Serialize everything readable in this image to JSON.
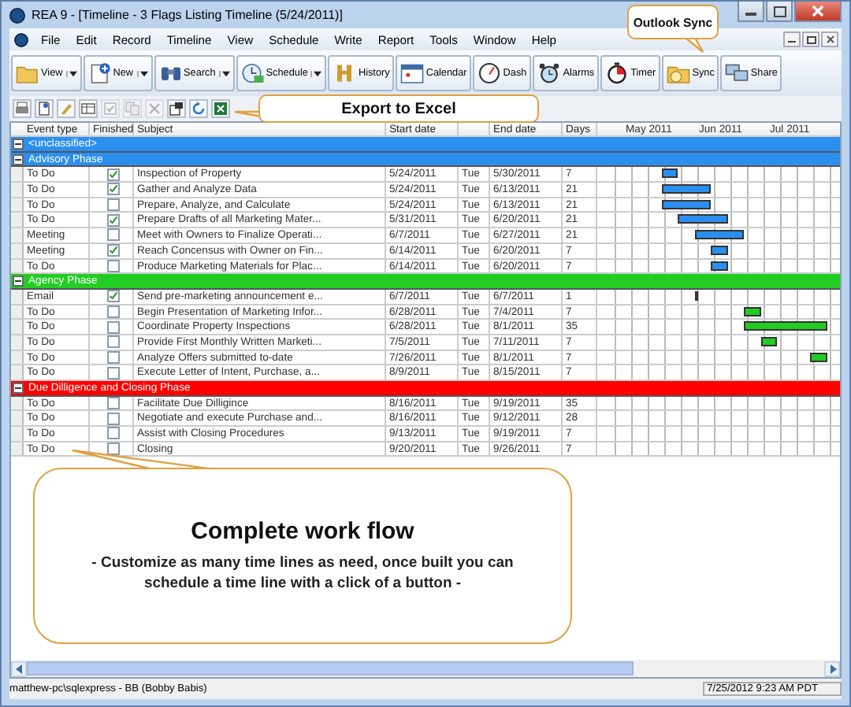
{
  "window": {
    "title": "REA 9 - [Timeline - 3 Flags Listing Timeline (5/24/2011)]"
  },
  "menu": [
    "File",
    "Edit",
    "Record",
    "Timeline",
    "View",
    "Schedule",
    "Write",
    "Report",
    "Tools",
    "Window",
    "Help"
  ],
  "toolbar": [
    {
      "label": "View",
      "dropdown": true
    },
    {
      "label": "New",
      "dropdown": true
    },
    {
      "label": "Search",
      "dropdown": true
    },
    {
      "label": "Schedule",
      "dropdown": true
    },
    {
      "label": "History",
      "dropdown": false
    },
    {
      "label": "Calendar",
      "dropdown": false
    },
    {
      "label": "Dash",
      "dropdown": false
    },
    {
      "label": "Alarms",
      "dropdown": false
    },
    {
      "label": "Timer",
      "dropdown": false
    },
    {
      "label": "Sync",
      "dropdown": false
    },
    {
      "label": "Share",
      "dropdown": false
    }
  ],
  "small_toolbar": [
    {
      "disabled": false
    },
    {
      "disabled": false
    },
    {
      "disabled": false
    },
    {
      "disabled": false
    },
    {
      "disabled": true
    },
    {
      "disabled": true
    },
    {
      "disabled": true
    },
    {
      "disabled": false
    },
    {
      "disabled": false
    },
    {
      "disabled": false
    }
  ],
  "callouts": {
    "outlook_sync": "Outlook Sync",
    "export": "Export to Excel",
    "workflow_title": "Complete work flow",
    "workflow_text": "- Customize as many time lines as need, once built you can schedule a time line with a click of a button -"
  },
  "grid": {
    "columns": [
      "Event type",
      "Finished",
      "Subject",
      "Start date",
      "End date",
      "Days"
    ],
    "months": [
      "May 2011",
      "Jun 2011",
      "Jul 2011"
    ],
    "groups": [
      {
        "name": "<unclassified>",
        "color": "#2b8ff0",
        "expanded": true
      },
      {
        "name": "Advisory Phase",
        "color": "#2b8ff0",
        "expanded": true,
        "rows": [
          {
            "event_type": "To Do",
            "finished": true,
            "subject": "Inspection of Property",
            "start_date": "5/24/2011",
            "weekday": "Tue",
            "end_date": "5/30/2011",
            "days": "7"
          },
          {
            "event_type": "To Do",
            "finished": true,
            "subject": "Gather and Analyze Data",
            "start_date": "5/24/2011",
            "weekday": "Tue",
            "end_date": "6/13/2011",
            "days": "21"
          },
          {
            "event_type": "To Do",
            "finished": false,
            "subject": "Prepare, Analyze, and Calculate",
            "start_date": "5/24/2011",
            "weekday": "Tue",
            "end_date": "6/13/2011",
            "days": "21"
          },
          {
            "event_type": "To Do",
            "finished": true,
            "subject": "Prepare Drafts of all Marketing Mater...",
            "start_date": "5/31/2011",
            "weekday": "Tue",
            "end_date": "6/20/2011",
            "days": "21"
          },
          {
            "event_type": "Meeting",
            "finished": false,
            "subject": "Meet with Owners to Finalize Operati...",
            "start_date": "6/7/2011",
            "weekday": "Tue",
            "end_date": "6/27/2011",
            "days": "21"
          },
          {
            "event_type": "Meeting",
            "finished": true,
            "subject": "Reach Concensus with Owner on Fin...",
            "start_date": "6/14/2011",
            "weekday": "Tue",
            "end_date": "6/20/2011",
            "days": "7"
          },
          {
            "event_type": "To Do",
            "finished": false,
            "subject": "Produce Marketing Materials for Plac...",
            "start_date": "6/14/2011",
            "weekday": "Tue",
            "end_date": "6/20/2011",
            "days": "7"
          }
        ]
      },
      {
        "name": "Agency Phase",
        "color": "#22cc22",
        "expanded": true,
        "rows": [
          {
            "event_type": "Email",
            "finished": true,
            "subject": "Send  pre-marketing announcement e...",
            "start_date": "6/7/2011",
            "weekday": "Tue",
            "end_date": "6/7/2011",
            "days": "1"
          },
          {
            "event_type": "To Do",
            "finished": false,
            "subject": "Begin Presentation of Marketing Infor...",
            "start_date": "6/28/2011",
            "weekday": "Tue",
            "end_date": "7/4/2011",
            "days": "7"
          },
          {
            "event_type": "To Do",
            "finished": false,
            "subject": "Coordinate Property Inspections",
            "start_date": "6/28/2011",
            "weekday": "Tue",
            "end_date": "8/1/2011",
            "days": "35"
          },
          {
            "event_type": "To Do",
            "finished": false,
            "subject": "Provide First Monthly Written Marketi...",
            "start_date": "7/5/2011",
            "weekday": "Tue",
            "end_date": "7/11/2011",
            "days": "7"
          },
          {
            "event_type": "To Do",
            "finished": false,
            "subject": "Analyze Offers submitted to-date",
            "start_date": "7/26/2011",
            "weekday": "Tue",
            "end_date": "8/1/2011",
            "days": "7"
          },
          {
            "event_type": "To Do",
            "finished": false,
            "subject": "Execute Letter of Intent, Purchase, a...",
            "start_date": "8/9/2011",
            "weekday": "Tue",
            "end_date": "8/15/2011",
            "days": "7"
          }
        ]
      },
      {
        "name": "Due Dilligence and Closing Phase",
        "color": "#ff0000",
        "expanded": true,
        "rows": [
          {
            "event_type": "To Do",
            "finished": false,
            "subject": "Facilitate Due Dilligince",
            "start_date": "8/16/2011",
            "weekday": "Tue",
            "end_date": "9/19/2011",
            "days": "35"
          },
          {
            "event_type": "To Do",
            "finished": false,
            "subject": "Negotiate and execute Purchase and...",
            "start_date": "8/16/2011",
            "weekday": "Tue",
            "end_date": "9/12/2011",
            "days": "28"
          },
          {
            "event_type": "To Do",
            "finished": false,
            "subject": "Assist with Closing Procedures",
            "start_date": "9/13/2011",
            "weekday": "Tue",
            "end_date": "9/19/2011",
            "days": "7"
          },
          {
            "event_type": "To Do",
            "finished": false,
            "subject": "Closing",
            "start_date": "9/20/2011",
            "weekday": "Tue",
            "end_date": "9/26/2011",
            "days": "7"
          }
        ]
      }
    ]
  },
  "status_bar": {
    "connection": "matthew-pc\\sqlexpress - BB (Bobby Babis)",
    "datetime": "7/25/2012 9:23 AM PDT"
  }
}
